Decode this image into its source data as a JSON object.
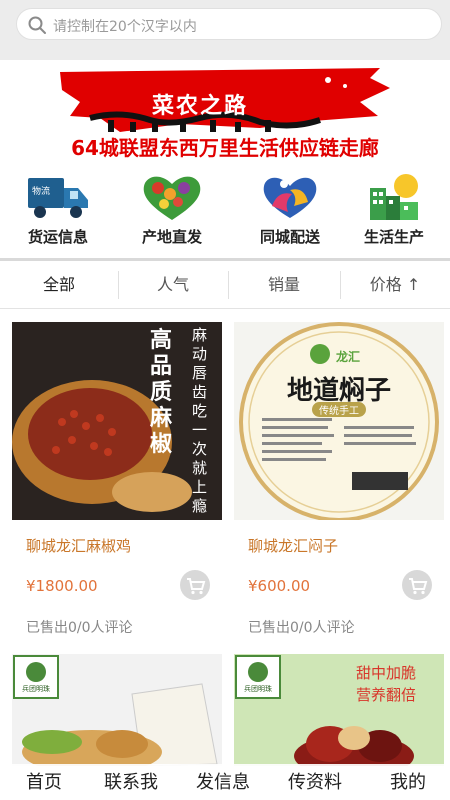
{
  "search": {
    "placeholder": "请控制在20个汉字以内"
  },
  "banner": {
    "title": "菜农之路",
    "subtitle": "64城联盟东西万里生活供应链走廊"
  },
  "categories": [
    {
      "label": "货运信息",
      "icon": "truck-icon"
    },
    {
      "label": "产地直发",
      "icon": "produce-heart-icon"
    },
    {
      "label": "同城配送",
      "icon": "hands-heart-icon"
    },
    {
      "label": "生活生产",
      "icon": "buildings-icon"
    }
  ],
  "sort_tabs": [
    {
      "label": "全部"
    },
    {
      "label": "人气"
    },
    {
      "label": "销量"
    },
    {
      "label": "价格 ↑"
    }
  ],
  "products": [
    {
      "name": "聊城龙汇麻椒鸡",
      "price": "¥1800.00",
      "stats": "已售出0/0人评论",
      "image_text": [
        "高品质麻椒",
        "麻动唇齿吃一次就上瘾"
      ]
    },
    {
      "name": "聊城龙汇闷子",
      "price": "¥600.00",
      "stats": "已售出0/0人评论",
      "image_text": [
        "龙汇",
        "地道焖子",
        "传统手工"
      ]
    },
    {
      "name": "",
      "price": "",
      "stats": "",
      "image_text": [
        "兵团明珠"
      ]
    },
    {
      "name": "",
      "price": "",
      "stats": "",
      "image_text": [
        "兵团明珠",
        "甜中加脆",
        "营养翻倍"
      ]
    }
  ],
  "bottom_nav": [
    {
      "label": "首页"
    },
    {
      "label": "联系我"
    },
    {
      "label": "发信息"
    },
    {
      "label": "传资料"
    },
    {
      "label": "我的"
    }
  ],
  "colors": {
    "banner_red": "#e00000",
    "price_orange": "#e2733b",
    "product_name": "#c9772a"
  }
}
